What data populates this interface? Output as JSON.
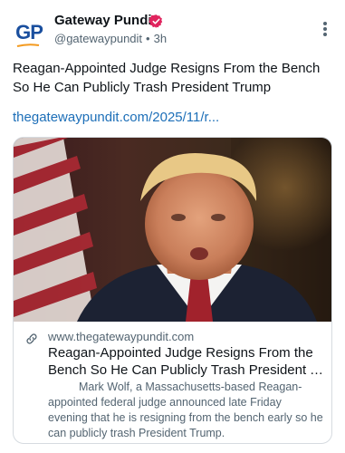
{
  "author": {
    "avatar_text": "GP",
    "name": "Gateway Pundit",
    "handle": "@gatewaypundit",
    "time": "3h",
    "separator": "•"
  },
  "post": {
    "text": "Reagan-Appointed Judge Resigns From the Bench So He Can Publicly Trash President Trump",
    "link": "thegatewaypundit.com/2025/11/r..."
  },
  "card": {
    "domain": "www.thegatewaypundit.com",
    "title_line1": "Reagan-Appointed Judge Resigns From the",
    "title_line2": "Bench So He Can Publicly Trash President Tru...",
    "description": "Mark Wolf, a Massachusetts-based Reagan-appointed federal judge announced late Friday evening that he is resigning from the bench early so he can publicly trash President Trump."
  },
  "icons": {
    "verified": "verified-badge-icon",
    "more": "more-options-icon",
    "link": "link-icon"
  },
  "colors": {
    "link_blue": "#1d6fb8",
    "verified_pink": "#e0245e",
    "brand_blue": "#1a4f9e",
    "brand_orange": "#f39a1f"
  }
}
